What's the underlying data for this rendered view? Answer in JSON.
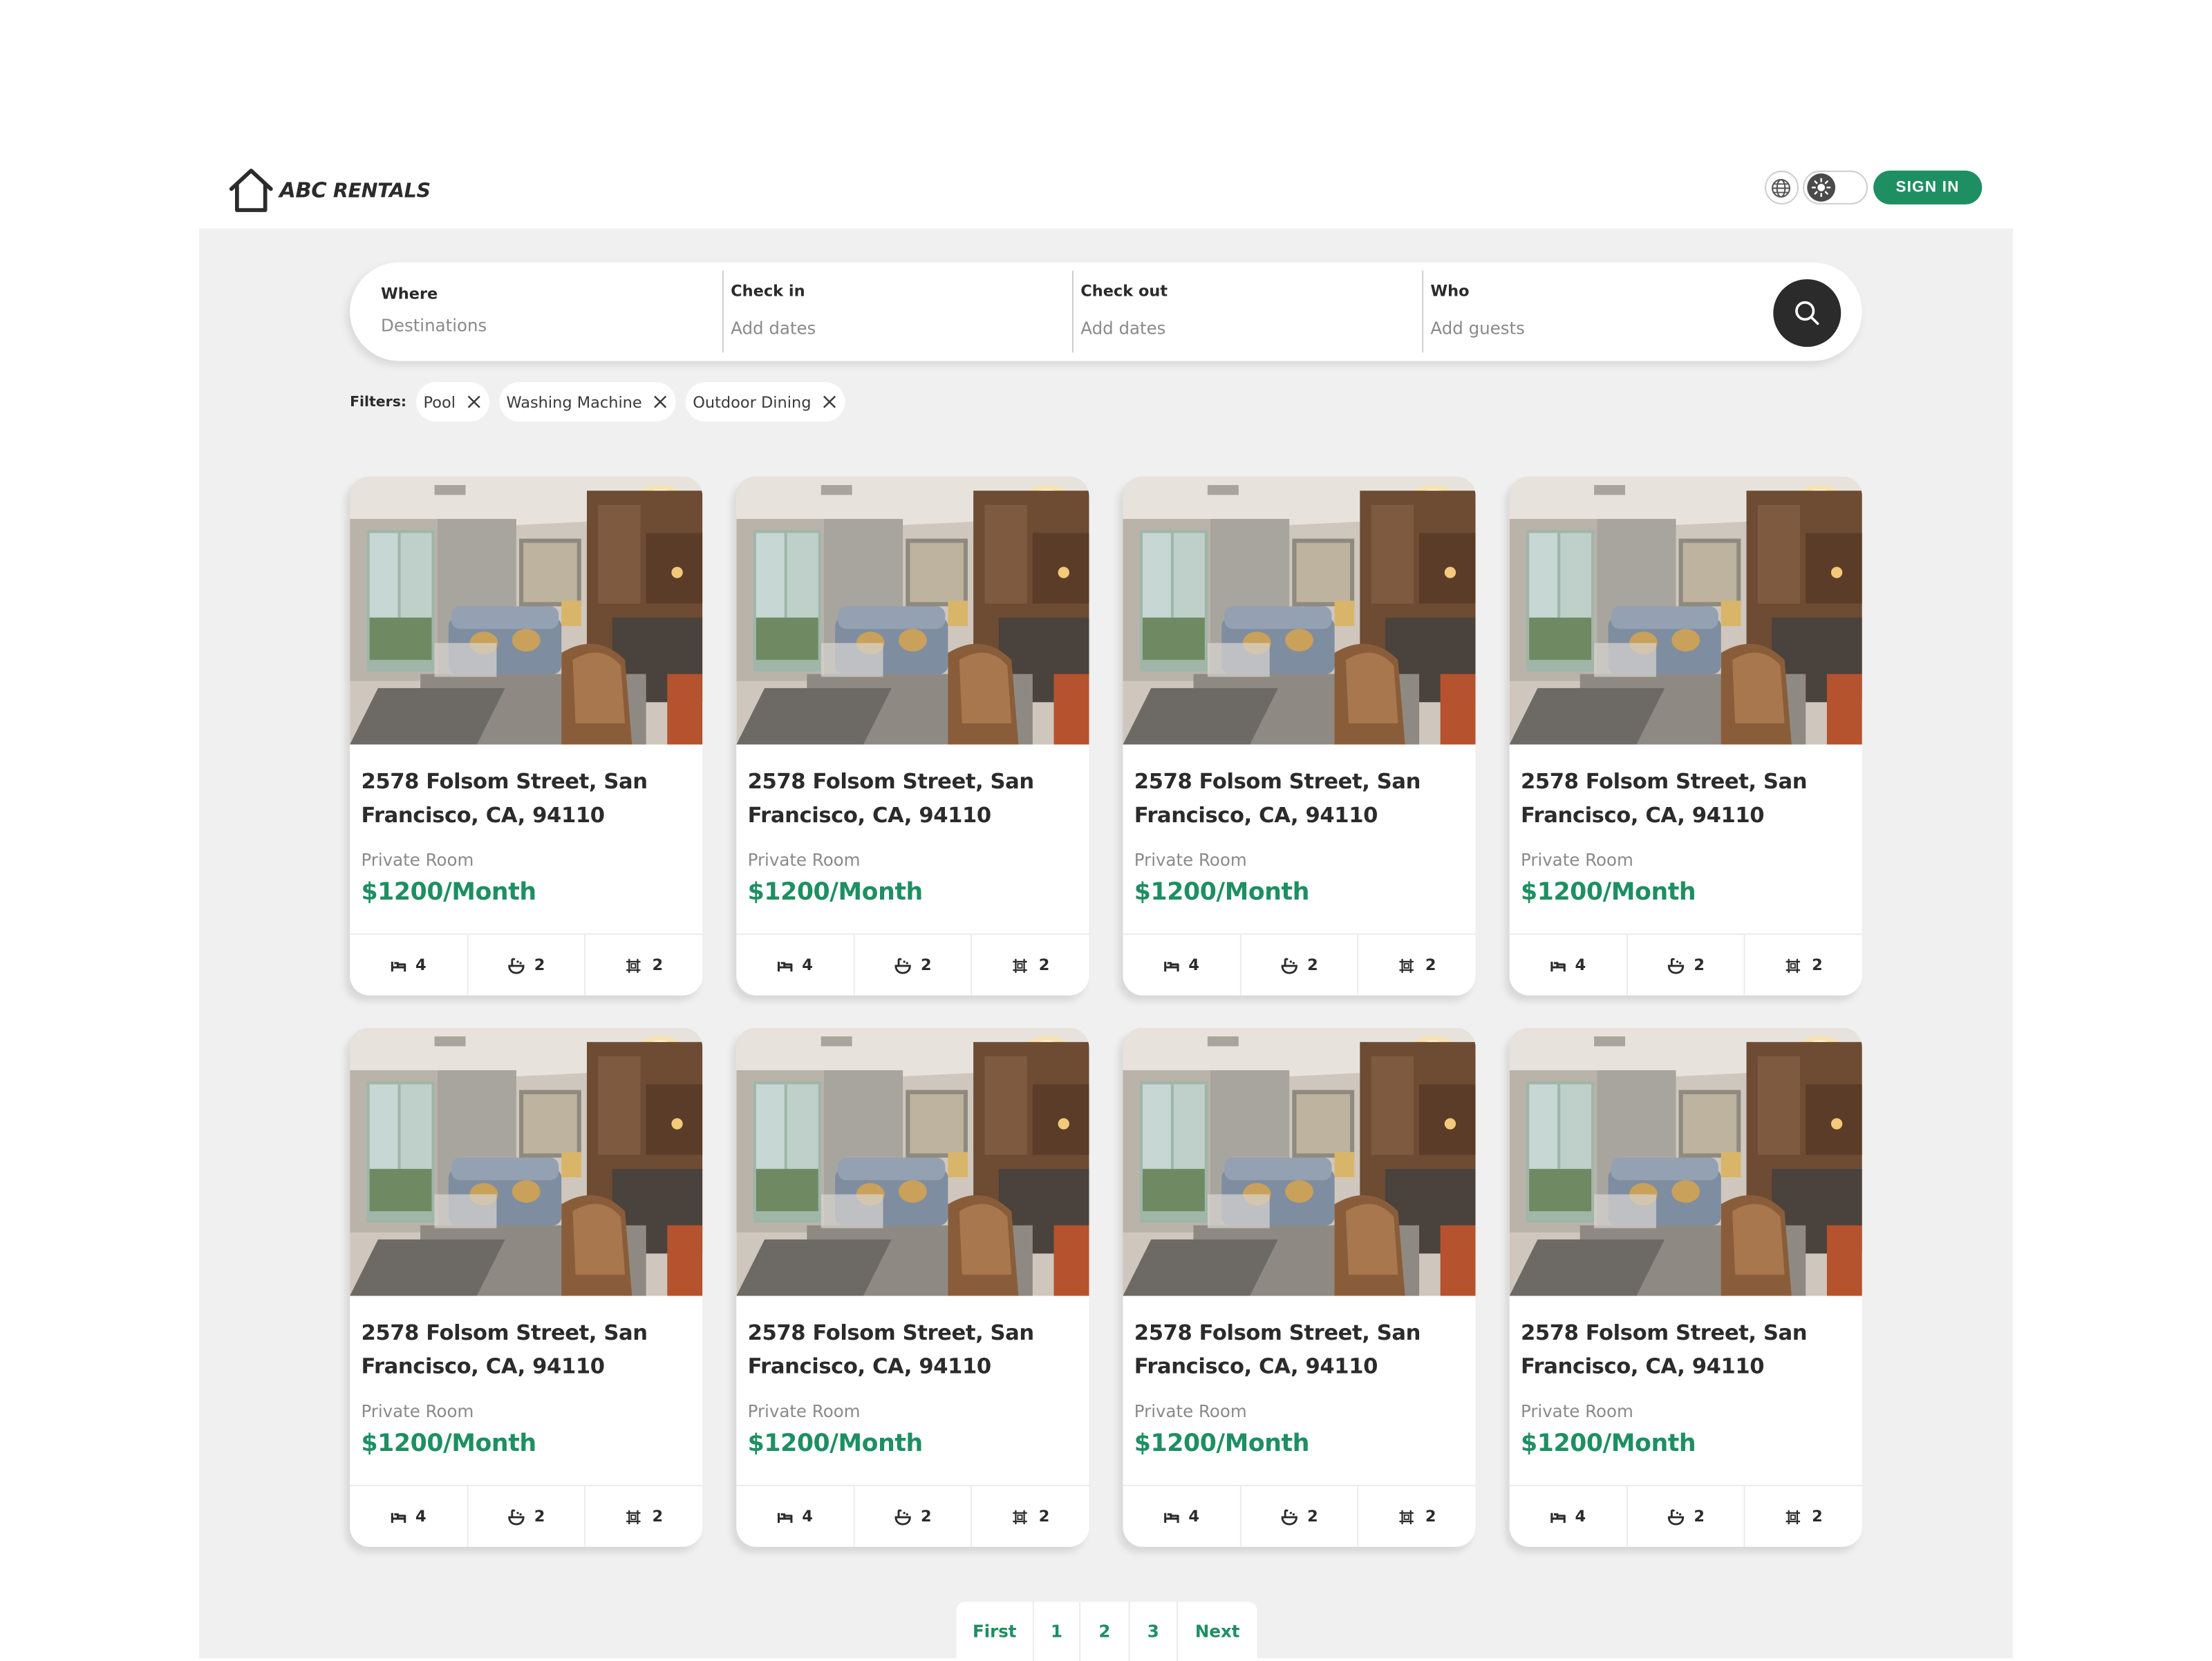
{
  "brand": {
    "name_part1": "ABC",
    "name_part2": "RENTALS"
  },
  "header": {
    "sign_in_label": "SIGN IN",
    "theme_icon": "sun-icon",
    "language_icon": "globe-icon"
  },
  "search": {
    "where": {
      "label": "Where",
      "placeholder": "Destinations"
    },
    "check_in": {
      "label": "Check in",
      "placeholder": "Add dates"
    },
    "check_out": {
      "label": "Check out",
      "placeholder": "Add dates"
    },
    "who": {
      "label": "Who",
      "placeholder": "Add guests"
    },
    "button_icon": "search-icon"
  },
  "filters": {
    "label": "Filters:",
    "chips": [
      "Pool",
      "Washing Machine",
      "Outdoor Dining"
    ]
  },
  "listings": [
    {
      "title": "2578 Folsom Street, San Francisco, CA, 94110",
      "type": "Private Room",
      "price": "$1200/Month",
      "beds": "4",
      "baths": "2",
      "area": "2"
    },
    {
      "title": "2578 Folsom Street, San Francisco, CA, 94110",
      "type": "Private Room",
      "price": "$1200/Month",
      "beds": "4",
      "baths": "2",
      "area": "2"
    },
    {
      "title": "2578 Folsom Street, San Francisco, CA, 94110",
      "type": "Private Room",
      "price": "$1200/Month",
      "beds": "4",
      "baths": "2",
      "area": "2"
    },
    {
      "title": "2578 Folsom Street, San Francisco, CA, 94110",
      "type": "Private Room",
      "price": "$1200/Month",
      "beds": "4",
      "baths": "2",
      "area": "2"
    },
    {
      "title": "2578 Folsom Street, San Francisco, CA, 94110",
      "type": "Private Room",
      "price": "$1200/Month",
      "beds": "4",
      "baths": "2",
      "area": "2"
    },
    {
      "title": "2578 Folsom Street, San Francisco, CA, 94110",
      "type": "Private Room",
      "price": "$1200/Month",
      "beds": "4",
      "baths": "2",
      "area": "2"
    },
    {
      "title": "2578 Folsom Street, San Francisco, CA, 94110",
      "type": "Private Room",
      "price": "$1200/Month",
      "beds": "4",
      "baths": "2",
      "area": "2"
    },
    {
      "title": "2578 Folsom Street, San Francisco, CA, 94110",
      "type": "Private Room",
      "price": "$1200/Month",
      "beds": "4",
      "baths": "2",
      "area": "2"
    }
  ],
  "pagination": {
    "first": "First",
    "pages": [
      "1",
      "2",
      "3"
    ],
    "next": "Next"
  },
  "colors": {
    "accent": "#1e8f62",
    "dark": "#2b2b2b",
    "background": "#f0f0f0"
  }
}
